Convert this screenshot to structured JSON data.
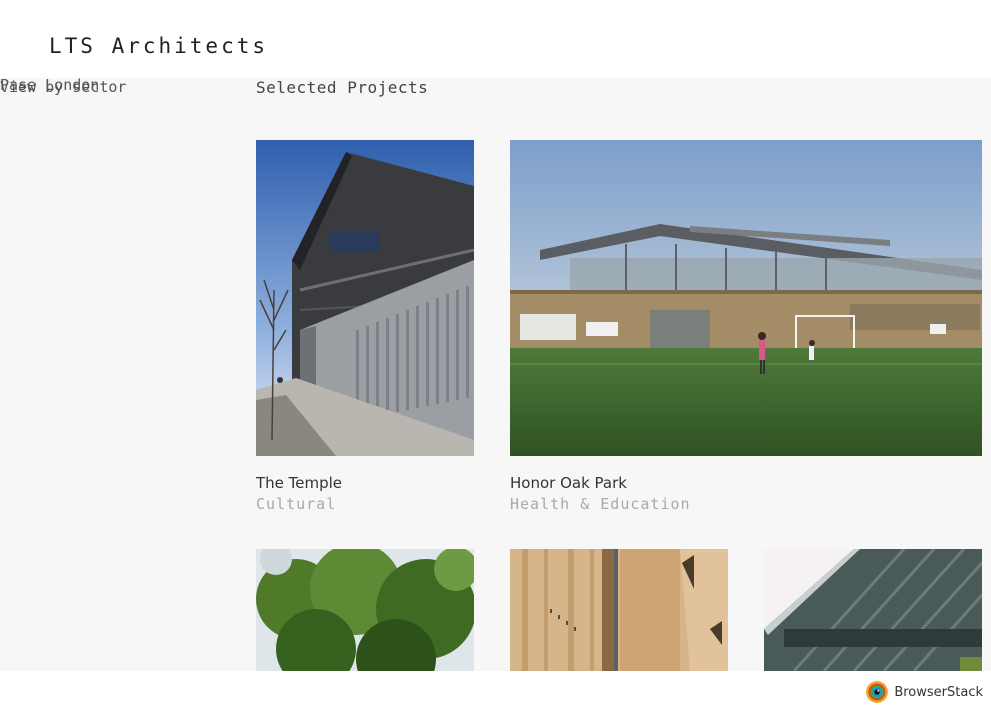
{
  "header": {
    "logo": "LTS Architects"
  },
  "sidebar": {
    "line_a": "Pase London",
    "line_b": "View by sector"
  },
  "main": {
    "heading": "Selected Projects",
    "projects": [
      {
        "title": "The Temple",
        "sector": "Cultural"
      },
      {
        "title": "Honor Oak Park",
        "sector": "Health & Education"
      }
    ]
  },
  "footer": {
    "brand": "BrowserStack"
  },
  "colors": {
    "sky": "#5d86c6",
    "field": "#3d6a2f",
    "timber": "#d7b58b",
    "sector_text": "#a9a9a9",
    "page_bg": "#f7f7f7"
  }
}
